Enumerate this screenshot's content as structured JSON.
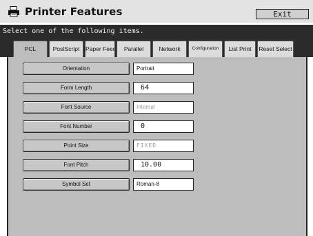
{
  "window": {
    "title": "Printer Features",
    "exit_label": "Exit",
    "icon": "printer-icon"
  },
  "instruction": "Select one of the following items.",
  "tabs": [
    {
      "label": "PCL",
      "active": true
    },
    {
      "label": "PostScript",
      "active": false
    },
    {
      "label": "Paper Feed",
      "active": false
    },
    {
      "label": "Parallel",
      "active": false
    },
    {
      "label": "Network",
      "active": false
    },
    {
      "label": "Configuration",
      "active": false
    },
    {
      "label": "List Print",
      "active": false
    },
    {
      "label": "Reset Select",
      "active": false
    }
  ],
  "settings": [
    {
      "label": "Orientation",
      "value": "Portrait"
    },
    {
      "label": "Form Length",
      "value": "64"
    },
    {
      "label": "Font Source",
      "value": "Internal"
    },
    {
      "label": "Font Number",
      "value": "0"
    },
    {
      "label": "Point Size",
      "value": "FIXED"
    },
    {
      "label": "Font Pitch",
      "value": "10.00"
    },
    {
      "label": "Symbol Set",
      "value": "Roman-8"
    }
  ]
}
